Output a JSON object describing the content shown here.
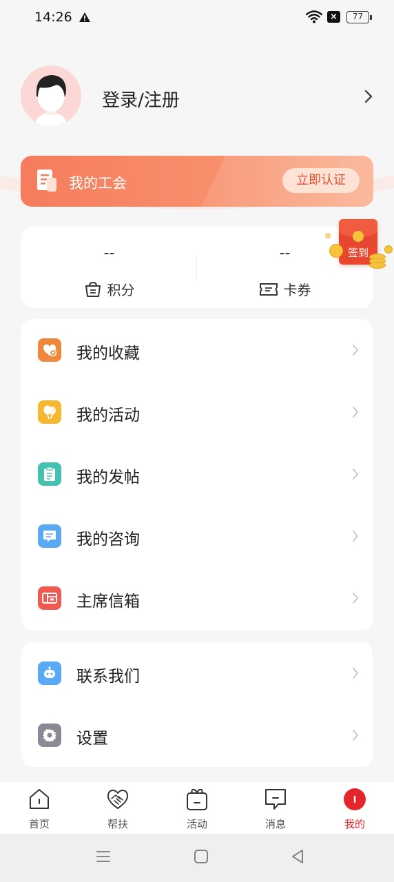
{
  "status_bar": {
    "time": "14:26",
    "battery": "77"
  },
  "profile": {
    "login_label": "登录/注册"
  },
  "union": {
    "label": "我的工会",
    "certify_button": "立即认证"
  },
  "stats": [
    {
      "value": "--",
      "label": "积分",
      "icon": "points-icon"
    },
    {
      "value": "--",
      "label": "卡券",
      "icon": "ticket-icon"
    }
  ],
  "signin": {
    "label": "签到"
  },
  "menu_primary": [
    {
      "label": "我的收藏",
      "icon": "favorite-icon",
      "color": "#f0883c"
    },
    {
      "label": "我的活动",
      "icon": "balloon-icon",
      "color": "#f7b731"
    },
    {
      "label": "我的发帖",
      "icon": "post-icon",
      "color": "#45c1b0"
    },
    {
      "label": "我的咨询",
      "icon": "consult-icon",
      "color": "#5aa9f5"
    },
    {
      "label": "主席信箱",
      "icon": "mailbox-icon",
      "color": "#f05a52"
    }
  ],
  "menu_secondary": [
    {
      "label": "联系我们",
      "icon": "robot-icon",
      "color": "#5aa9f5"
    },
    {
      "label": "设置",
      "icon": "gear-icon",
      "color": "#8a8a96"
    }
  ],
  "tabs": [
    {
      "label": "首页",
      "icon": "home-icon"
    },
    {
      "label": "帮扶",
      "icon": "handshake-icon"
    },
    {
      "label": "活动",
      "icon": "gift-icon"
    },
    {
      "label": "消息",
      "icon": "message-icon"
    },
    {
      "label": "我的",
      "icon": "profile-icon",
      "active": true
    }
  ],
  "colors": {
    "accent": "#e4262c",
    "union_gradient_start": "#f57c5d",
    "union_gradient_end": "#fbb090"
  }
}
